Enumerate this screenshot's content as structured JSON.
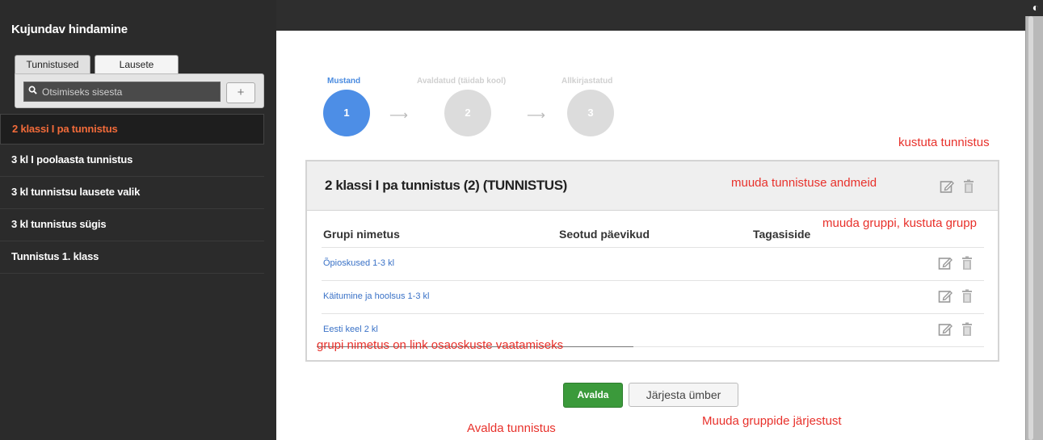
{
  "sidebar": {
    "title": "Kujundav hindamine",
    "tabs": [
      {
        "label": "Tunnistused"
      },
      {
        "label": "Lausete"
      }
    ],
    "search": {
      "placeholder": "Otsimiseks sisesta"
    },
    "add_label": "+",
    "items": [
      {
        "label": "2 klassi I pa tunnistus"
      },
      {
        "label": "3 kl I poolaasta tunnistus"
      },
      {
        "label": "3 kl tunnistsu lausete valik"
      },
      {
        "label": "3 kl tunnistus sügis"
      },
      {
        "label": "Tunnistus 1. klass"
      }
    ]
  },
  "steps": [
    {
      "label": "Mustand",
      "number": "1"
    },
    {
      "label": "Avaldatud (täidab kool)",
      "number": "2"
    },
    {
      "label": "Allkirjastatud",
      "number": "3"
    }
  ],
  "card": {
    "title": "2 klassi I pa tunnistus (2) (TUNNISTUS)",
    "columns": [
      "Grupi nimetus",
      "Seotud päevikud",
      "Tagasiside"
    ],
    "rows": [
      {
        "name": "Õpioskused 1-3 kl"
      },
      {
        "name": "Käitumine ja hoolsus 1-3 kl"
      },
      {
        "name": "Eesti keel 2 kl"
      }
    ]
  },
  "buttons": {
    "publish": "Avalda",
    "reorder": "Järjesta ümber"
  },
  "annotations": {
    "delete_certificate": "kustuta tunnistus",
    "edit_certificate": "muuda tunnistuse andmeid",
    "edit_group": "muuda gruppi, kustuta grupp",
    "group_link": "grupi nimetus on link osaoskuste vaatamiseks",
    "publish": "Avalda tunnistus",
    "reorder": "Muuda gruppide järjestust"
  },
  "colors": {
    "accent": "#4d8ee6",
    "active_nav": "#f26b3a",
    "annotation": "#e8312b",
    "publish": "#3b9a3b"
  }
}
